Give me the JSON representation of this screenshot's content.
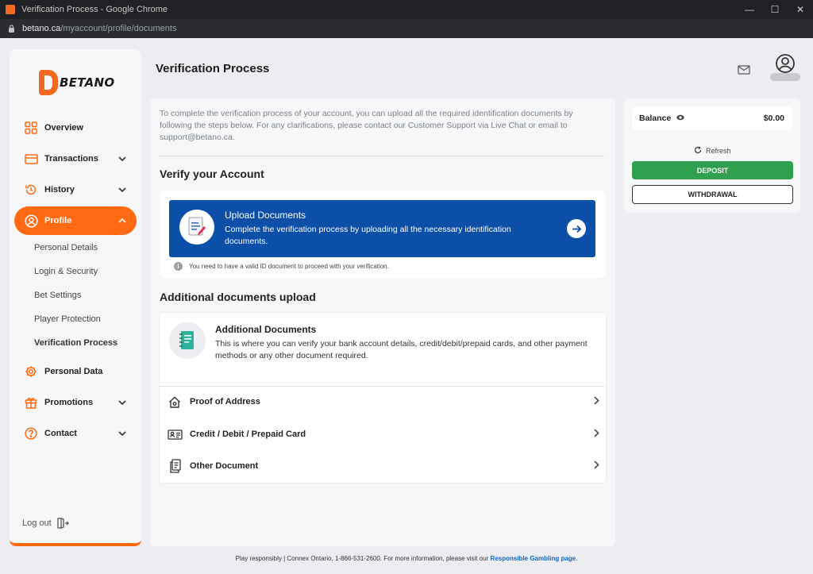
{
  "window": {
    "title": "Verification Process - Google Chrome",
    "url_host": "betano.ca",
    "url_path": "/myaccount/profile/documents"
  },
  "brand": {
    "name": "BETANO",
    "accent": "#ff6a13"
  },
  "sidebar": {
    "items": [
      {
        "label": "Overview",
        "icon": "grid-icon"
      },
      {
        "label": "Transactions",
        "icon": "card-icon"
      },
      {
        "label": "History",
        "icon": "history-icon"
      },
      {
        "label": "Profile",
        "icon": "user-icon"
      },
      {
        "label": "Personal Data",
        "icon": "gear-icon"
      },
      {
        "label": "Promotions",
        "icon": "gift-icon"
      },
      {
        "label": "Contact",
        "icon": "help-icon"
      }
    ],
    "profile_sub": [
      "Personal Details",
      "Login & Security",
      "Bet Settings",
      "Player Protection",
      "Verification Process"
    ],
    "logout_label": "Log out"
  },
  "main": {
    "title": "Verification Process",
    "intro": "To complete the verification process of your account, you can upload all the required identification documents by following the steps below. For any clarifications, please contact our Customer Support via Live Chat or email to support@betano.ca.",
    "verify_heading": "Verify your Account",
    "upload": {
      "title": "Upload Documents",
      "desc": "Complete the verification process by uploading all the necessary identification documents.",
      "note": "You need to have a valid ID document to proceed with your verification."
    },
    "additional_heading": "Additional documents upload",
    "additional": {
      "title": "Additional Documents",
      "desc": "This is where you can verify your bank account details, credit/debit/prepaid cards, and other payment methods or any other document required.",
      "rows": [
        "Proof of Address",
        "Credit / Debit / Prepaid Card",
        "Other Document"
      ]
    }
  },
  "balance": {
    "label": "Balance",
    "value": "$0.00",
    "refresh": "Refresh",
    "deposit": "DEPOSIT",
    "withdrawal": "WITHDRAWAL"
  },
  "footer": {
    "text": "Play responsibly | Connex Ontario, 1-866-531-2600. For more information, please visit our",
    "link": "Responsible Gambling page",
    "end": "."
  }
}
